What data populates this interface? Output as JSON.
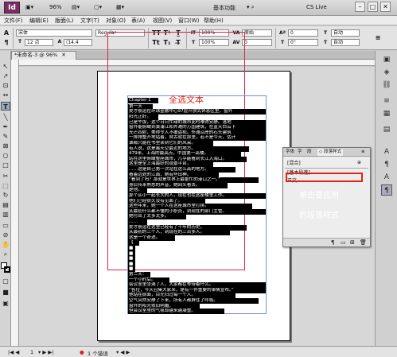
{
  "app": {
    "logo": "Id",
    "zoom": "96%",
    "workspace": "基本功能",
    "cs_live": "CS Live"
  },
  "menu": [
    "文件(F)",
    "编辑(E)",
    "版面(L)",
    "文字(T)",
    "对象(O)",
    "表(A)",
    "视图(V)",
    "窗口(W)",
    "帮助(H)"
  ],
  "control": {
    "font_family": "宋体",
    "font_style": "Regular",
    "font_size": "12 点",
    "leading": "(14.4",
    "scale_h": "100%",
    "scale_v": "100%",
    "tracking": "0",
    "baseline": "0 点",
    "language": "原始",
    "kerning": "0",
    "rotate": "0°",
    "auto1": "自动",
    "auto2": "自动"
  },
  "doc_tab": "*未命名-3 @ 96%",
  "text_lines": [
    "Chapter 1",
    "第一天",
    "爱才航运在环球金融中心97层开放式休息区里，窗外",
    "阳光正好。",
    "已是午饭，这个日日忙碌的城市此时难得安静。落地",
    "窗外能俯瞰到黄浦江和外滩的万国建筑，在蓝天白云下",
    "光芒四射，美得令人不敢逼视。外滩沿岸的石头建筑",
    "一排排整齐地站着，自古就在那里，若不是今天，估计",
    "谁都只能在书里读到它们的风采。",
    "有人说，这是离天空最近的地方。",
    "479米，上海的最高点，中国第一高楼。",
    "站在这里俯瞰整座城市，几乎能看到长江入海口。",
    "这里是全上海最好的观景平台，",
    "……这是自己第一次站在这么高的地方。",
    "看着远处的江面，她有些出神。",
    "“看到了吗？那就是世界上最繁忙的港口之一。”",
    "身后传来熟悉的声音，她回头看去。",
    "是他。",
    "那个从小一起长大的人，现在也在这座楼里工作。",
    "他们已经很久没有见面了。",
    "这些年来，她一个人在这座城市里打拼。",
    "从最初什么都不懂的小职员，到现在的部门主管。",
    "她付出了太多太多。",
    "……",
    "爱才航运在这里已经有了十年的历史。",
    "从最初的三个人，到现在的三百多人。",
    "这是一个奇迹。",
    "【",
    "■",
    "■",
    "■",
    "■",
    "■",
    "第二天：",
    "一个小时后。",
    "会议室里坐满了人，大家都在等待着什么。",
    "“各位，今天召集大家来，是有一件重要的事情宣布。”",
    "他站在前面，目光扫过每一个人。",
    "空气突然安静了下来，所有人都屏住了呼吸。",
    "窗外的阳光依旧明媚，",
    "但会议室里的气氛却越来越凝重。"
  ],
  "paragraph_panel": {
    "tabs": [
      "字体",
      "字",
      "段",
      "◇ 段落样式"
    ],
    "current": "[混合]",
    "styles": [
      "[基本段落]",
      "正文"
    ]
  },
  "annotations": {
    "select_all": "全选文本",
    "click_style_line1": "单击要应用",
    "click_style_line2": "的段落样式"
  },
  "status": {
    "page": "1",
    "errors": "1 个错误"
  }
}
